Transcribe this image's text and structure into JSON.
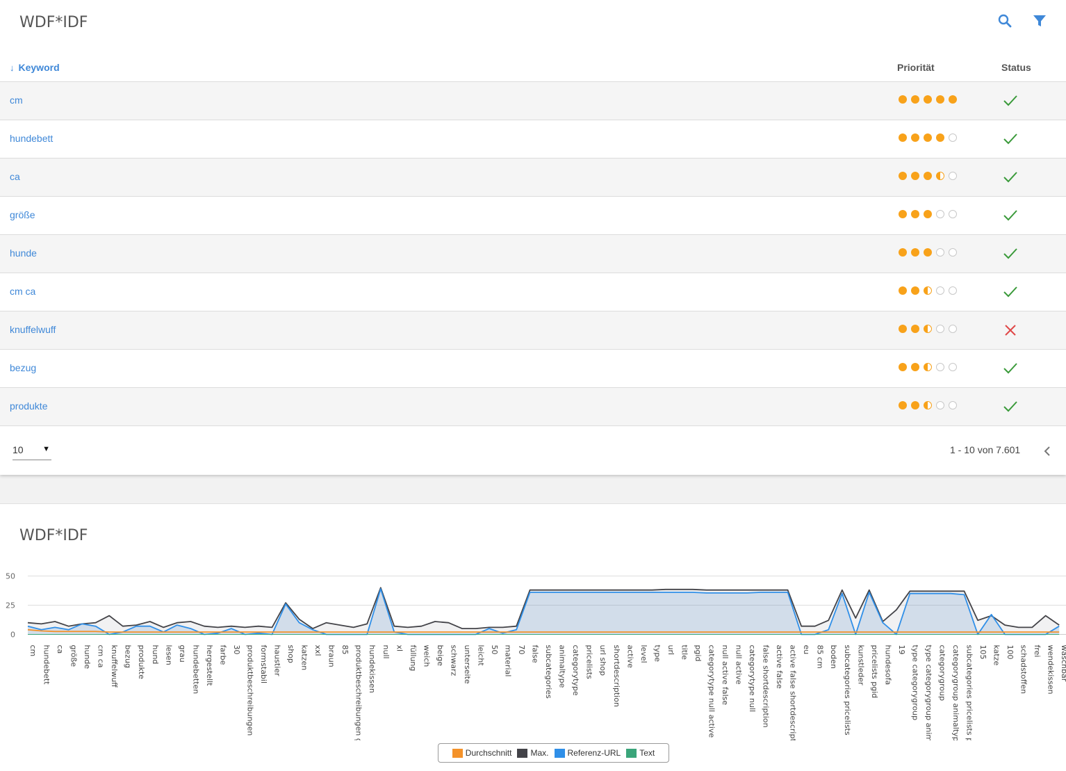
{
  "colors": {
    "accent": "#3f88d8",
    "star": "#f8a21a",
    "ok": "#3a9a3a",
    "error": "#e04848"
  },
  "table_card": {
    "title": "WDF*IDF",
    "toolbar": {
      "search_icon": "search-icon",
      "filter_icon": "filter-icon"
    },
    "columns": {
      "keyword": "Keyword",
      "priority": "Priorität",
      "status": "Status"
    },
    "rows": [
      {
        "keyword": "cm",
        "priority": 5,
        "status": "ok"
      },
      {
        "keyword": "hundebett",
        "priority": 4,
        "status": "ok"
      },
      {
        "keyword": "ca",
        "priority": 3.5,
        "status": "ok"
      },
      {
        "keyword": "größe",
        "priority": 3,
        "status": "ok"
      },
      {
        "keyword": "hunde",
        "priority": 3,
        "status": "ok"
      },
      {
        "keyword": "cm ca",
        "priority": 2.5,
        "status": "ok"
      },
      {
        "keyword": "knuffelwuff",
        "priority": 2.5,
        "status": "error"
      },
      {
        "keyword": "bezug",
        "priority": 2.5,
        "status": "ok"
      },
      {
        "keyword": "produkte",
        "priority": 2.5,
        "status": "ok"
      }
    ],
    "pagination": {
      "page_size": "10",
      "info": "1 - 10 von 7.601"
    }
  },
  "chart_card": {
    "title": "WDF*IDF"
  },
  "chart_data": {
    "type": "area",
    "title": "WDF*IDF",
    "ylim": [
      0,
      50
    ],
    "yticks": [
      0,
      25,
      50
    ],
    "grid": true,
    "legend_position": "bottom",
    "categories": [
      "cm",
      "hundebett",
      "ca",
      "größe",
      "hunde",
      "cm ca",
      "knuffelwuff",
      "bezug",
      "produkte",
      "hund",
      "lesen",
      "grau",
      "hundebetten",
      "hergestellt",
      "farbe",
      "30",
      "produktbeschreibungen",
      "formstabil",
      "haustier",
      "shop",
      "katzen",
      "xxl",
      "braun",
      "85",
      "produktbeschreibungen größe",
      "hundekissen",
      "null",
      "xl",
      "füllung",
      "weich",
      "beige",
      "schwarz",
      "unterseite",
      "leicht",
      "50",
      "material",
      "70",
      "false",
      "subcategories",
      "animaltype",
      "categorytype",
      "pricelists",
      "url shop",
      "shortdescription",
      "active",
      "level",
      "type",
      "url",
      "title",
      "pgid",
      "categorytype null active",
      "null active false",
      "null active",
      "categorytype null",
      "false shortdescription",
      "active false",
      "active false shortdescription",
      "eu",
      "85 cm",
      "boden",
      "subcategories pricelists",
      "kunstleder",
      "pricelists pgid",
      "hundesofa",
      "19",
      "type categorygroup",
      "type categorygroup animaltype",
      "categorygroup",
      "categorygroup animaltype",
      "subcategories pricelists pgid",
      "105",
      "katze",
      "100",
      "schadstoffen",
      "frei",
      "wendekissen",
      "waschbar"
    ],
    "series": [
      {
        "name": "Durchschnitt",
        "color": "#f4922a",
        "values": [
          4,
          3,
          2.5,
          2.5,
          2.5,
          2.5,
          2,
          2,
          2,
          2,
          2,
          2,
          2,
          2,
          2,
          2,
          2,
          2,
          2,
          2,
          2,
          2,
          2,
          2,
          2,
          2,
          2,
          2,
          2,
          2,
          2,
          2,
          2,
          2,
          2,
          2,
          2,
          2,
          2,
          2,
          2,
          2,
          2,
          2,
          2,
          2,
          2,
          2,
          2,
          2,
          2,
          2,
          2,
          2,
          2,
          2,
          2,
          2,
          2,
          2,
          2,
          2,
          2,
          2,
          2,
          2,
          2,
          2,
          2,
          2,
          2,
          2,
          2,
          2,
          2,
          2,
          2
        ]
      },
      {
        "name": "Max.",
        "color": "#434348",
        "values": [
          10,
          9,
          11,
          7,
          9,
          10,
          16,
          7,
          8,
          11,
          6,
          10,
          11,
          7,
          6,
          7,
          6,
          7,
          6,
          27,
          13,
          5,
          10,
          8,
          6,
          9,
          40,
          7,
          6,
          7,
          11,
          10,
          5,
          5,
          6,
          6,
          7,
          38,
          38,
          38,
          38,
          38,
          38,
          38,
          38,
          38,
          38,
          38.5,
          38.5,
          38.5,
          38,
          38,
          38,
          38,
          38,
          38,
          38,
          7,
          7,
          12,
          38,
          14,
          38,
          11,
          21,
          37,
          37,
          37,
          37,
          37,
          12,
          16,
          8,
          6,
          6,
          16,
          8
        ]
      },
      {
        "name": "Referenz-URL",
        "color": "#2f8fe8",
        "values": [
          7,
          4,
          6,
          4,
          9,
          7,
          0,
          2,
          7,
          7,
          2,
          8,
          5,
          0,
          1,
          5,
          0,
          1,
          0,
          26,
          10,
          4,
          0,
          0,
          0,
          0,
          39,
          2,
          0,
          0,
          0,
          0,
          0,
          0,
          5,
          1,
          4,
          36,
          36,
          36,
          36,
          36,
          36,
          36,
          36,
          36,
          36,
          36,
          36,
          36,
          35.5,
          35.5,
          35.5,
          35.5,
          36,
          36,
          36,
          0,
          0,
          4,
          35,
          0,
          36,
          10,
          0,
          35,
          35,
          35,
          35,
          34,
          0,
          17,
          0,
          0,
          0,
          0,
          7
        ]
      },
      {
        "name": "Text",
        "color": "#3aa57a",
        "values": [
          0,
          0,
          0,
          0,
          0,
          0,
          0,
          0,
          0,
          0,
          0,
          0,
          0,
          0,
          0,
          0,
          0,
          0,
          0,
          0,
          0,
          0,
          0,
          0,
          0,
          0,
          0,
          0,
          0,
          0,
          0,
          0,
          0,
          0,
          0,
          0,
          0,
          0,
          0,
          0,
          0,
          0,
          0,
          0,
          0,
          0,
          0,
          0,
          0,
          0,
          0,
          0,
          0,
          0,
          0,
          0,
          0,
          0,
          0,
          0,
          0,
          0,
          0,
          0,
          0,
          0,
          0,
          0,
          0,
          0,
          0,
          0,
          0,
          0,
          0,
          0,
          0
        ]
      }
    ]
  }
}
